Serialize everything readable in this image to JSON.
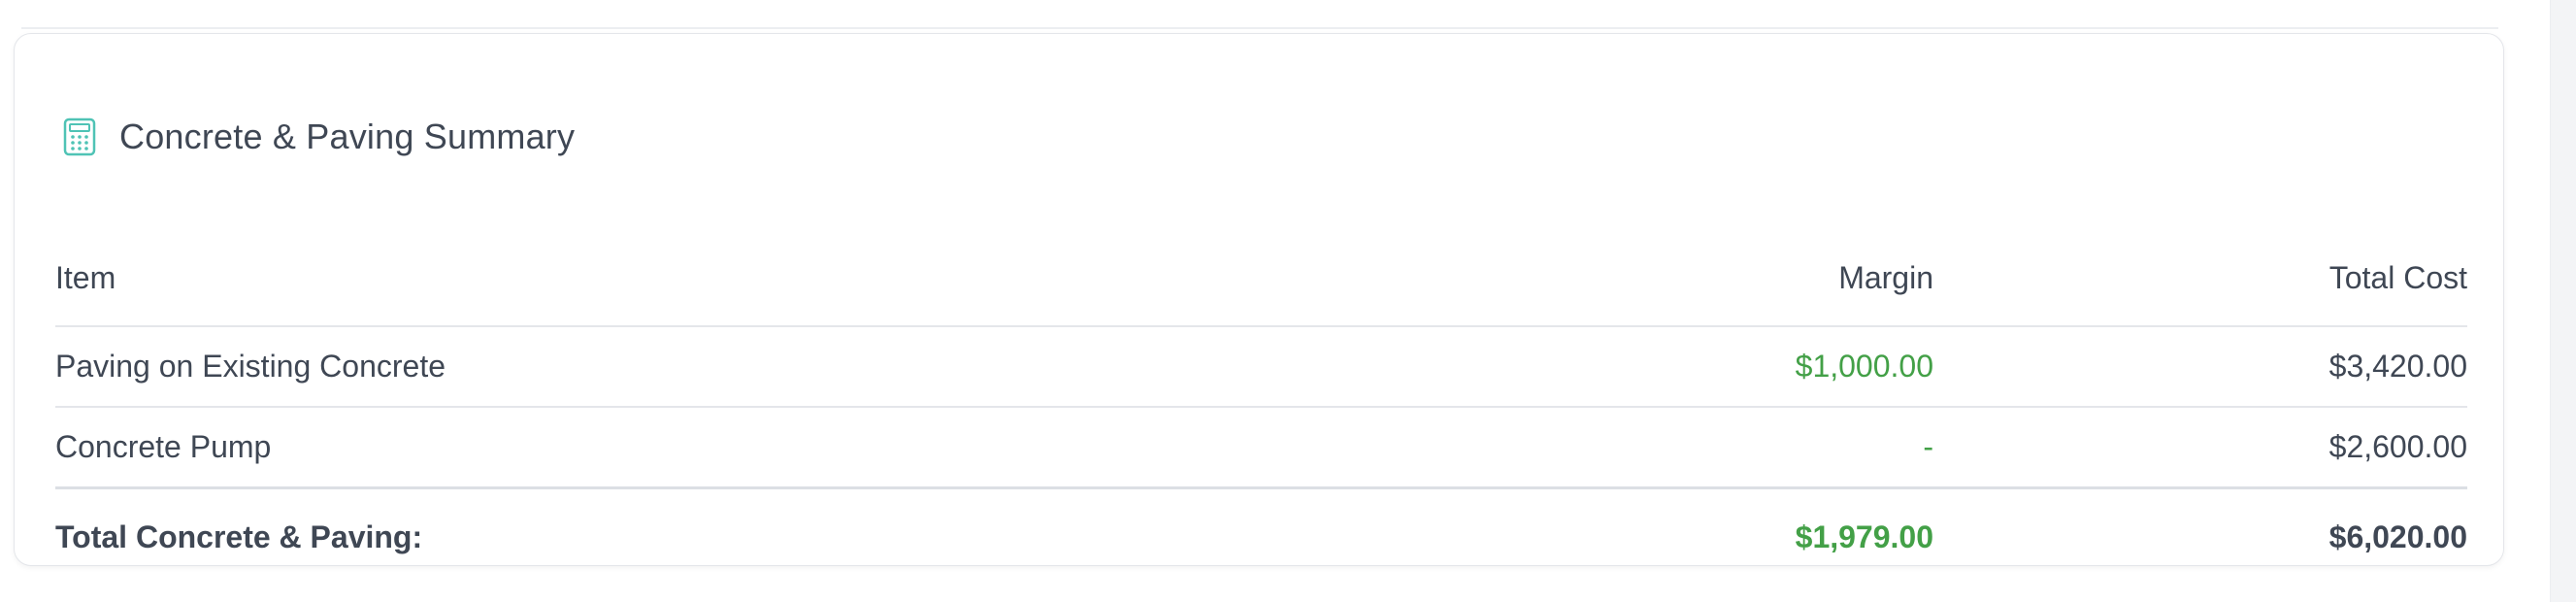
{
  "header": {
    "icon": "calculator-icon",
    "title": "Concrete & Paving Summary"
  },
  "table": {
    "columns": {
      "item": "Item",
      "margin": "Margin",
      "total_cost": "Total Cost"
    },
    "rows": [
      {
        "item": "Paving on Existing Concrete",
        "margin": "$1,000.00",
        "total_cost": "$3,420.00"
      },
      {
        "item": "Concrete Pump",
        "margin": "-",
        "total_cost": "$2,600.00"
      }
    ],
    "footer": {
      "label": "Total Concrete & Paving:",
      "margin": "$1,979.00",
      "total_cost": "$6,020.00"
    }
  },
  "colors": {
    "margin_green": "#43a047",
    "icon_teal": "#4fc3b5",
    "text": "#3f4754",
    "border": "#e4e6ea"
  }
}
